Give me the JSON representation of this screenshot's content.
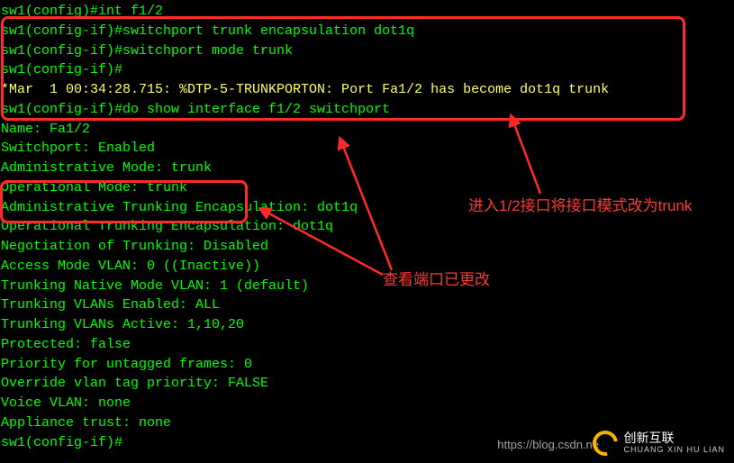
{
  "terminal": {
    "lines": [
      {
        "prompt": "sw1(config)#",
        "cmd": "int f1/2",
        "cls": ""
      },
      {
        "prompt": "sw1(config-if)#",
        "cmd": "switchport trunk encapsulation dot1q",
        "cls": ""
      },
      {
        "prompt": "sw1(config-if)#",
        "cmd": "switchport mode trunk",
        "cls": ""
      },
      {
        "prompt": "sw1(config-if)#",
        "cmd": "",
        "cls": ""
      },
      {
        "text": "*Mar  1 00:34:28.715: %DTP-5-TRUNKPORTON: Port Fa1/2 has become dot1q trunk",
        "cls": "yellow"
      },
      {
        "prompt": "sw1(config-if)#",
        "cmd": "do show interface f1/2 switchport",
        "cls": ""
      },
      {
        "text": "Name: Fa1/2",
        "cls": ""
      },
      {
        "text": "Switchport: Enabled",
        "cls": ""
      },
      {
        "text": "Administrative Mode: trunk",
        "cls": ""
      },
      {
        "text": "Operational Mode: trunk",
        "cls": ""
      },
      {
        "text": "Administrative Trunking Encapsulation: dot1q",
        "cls": ""
      },
      {
        "text": "Operational Trunking Encapsulation: dot1q",
        "cls": ""
      },
      {
        "text": "Negotiation of Trunking: Disabled",
        "cls": ""
      },
      {
        "text": "Access Mode VLAN: 0 ((Inactive))",
        "cls": ""
      },
      {
        "text": "Trunking Native Mode VLAN: 1 (default)",
        "cls": ""
      },
      {
        "text": "Trunking VLANs Enabled: ALL",
        "cls": ""
      },
      {
        "text": "Trunking VLANs Active: 1,10,20",
        "cls": ""
      },
      {
        "text": "Protected: false",
        "cls": ""
      },
      {
        "text": "Priority for untagged frames: 0",
        "cls": ""
      },
      {
        "text": "Override vlan tag priority: FALSE",
        "cls": ""
      },
      {
        "text": "Voice VLAN: none",
        "cls": ""
      },
      {
        "text": "Appliance trust: none",
        "cls": ""
      },
      {
        "prompt": "sw1(config-if)#",
        "cmd": "",
        "cls": ""
      }
    ]
  },
  "annotations": {
    "a1": "查看端口已更改",
    "a2": "进入1/2接口将接口模式改为trunk"
  },
  "watermark": {
    "url": "https://blog.csdn.ne",
    "brand": "创新互联",
    "brand_sub": "CHUANG XIN HU LIAN"
  }
}
